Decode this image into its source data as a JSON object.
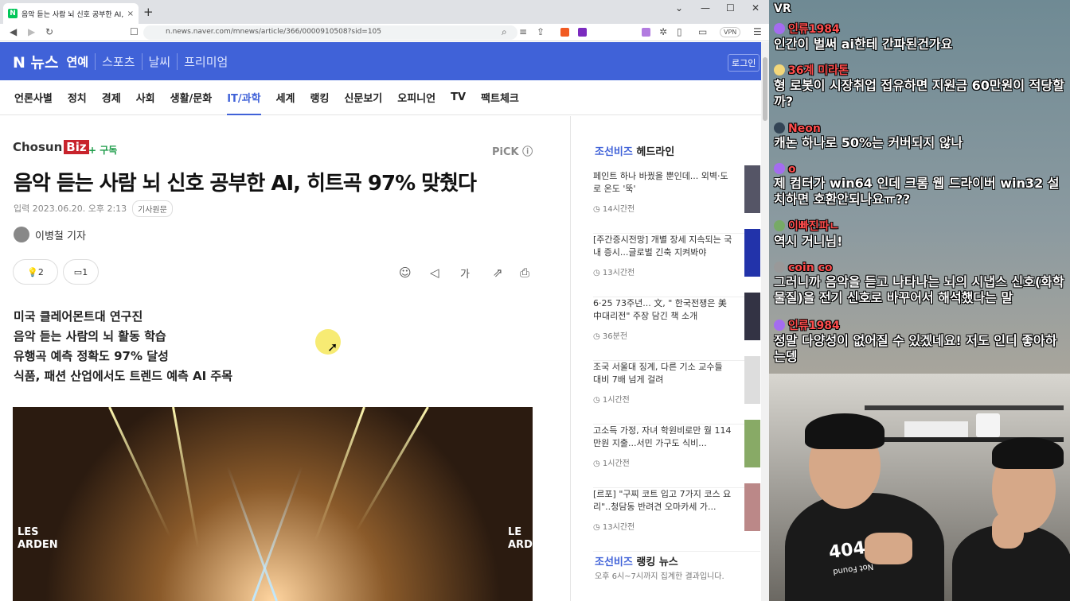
{
  "tab": {
    "title": "음악 듣는 사람 뇌 신호 공부한 AI, 히트곡 97% 맞췄다",
    "favicon": "N",
    "close": "×",
    "newtab": "+"
  },
  "window": {
    "min": "⌄",
    "max": "—",
    "restore": "☐",
    "close": "✕"
  },
  "address": {
    "url": "n.news.naver.com/mnews/article/366/0000910508?sid=105",
    "vpn": "VPN"
  },
  "naver": {
    "logo": "N 뉴스",
    "nav": [
      "연예",
      "스포츠",
      "날씨",
      "프리미엄"
    ],
    "login": "로그인"
  },
  "categories": [
    "언론사별",
    "정치",
    "경제",
    "사회",
    "생활/문화",
    "IT/과학",
    "세계",
    "랭킹",
    "신문보기",
    "오피니언",
    "TV",
    "팩트체크"
  ],
  "article": {
    "press": "Chosun",
    "press_suffix": "Biz",
    "subscribe": "+ 구독",
    "pick": "PiCK ⓘ",
    "headline": "음악 듣는 사람 뇌 신호 공부한 AI, 히트곡 97% 맞췄다",
    "date": "입력 2023.06.20. 오후 2:13",
    "original": "기사원문",
    "reporter": "이병철 기자",
    "reactions": {
      "like_count": "2",
      "comment_count": "1",
      "font_label": "가"
    },
    "summary": [
      "미국 클레어몬트대 연구진",
      "음악 듣는 사람의 뇌 활동 학습",
      "유행곡 예측 정확도 97% 달성",
      "식품, 패션 산업에서도 트렌드 예측 AI 주목"
    ],
    "photo_text_left": "LES ARDEN",
    "photo_text_right": "LE ARD"
  },
  "sidebar": {
    "title_brand": "조선비즈",
    "title": "헤드라인",
    "items": [
      {
        "text": "페인트 하나 바꿨을 뿐인데... 외벽·도로 온도 '뚝'",
        "time": "14시간전"
      },
      {
        "text": "[주간증시전망] 개별 장세 지속되는 국내 증시...글로벌 긴축 지켜봐야",
        "time": "13시간전"
      },
      {
        "text": "6·25 73주년... 文, \" 한국전쟁은 美中대리전\" 주장 담긴 책 소개",
        "time": "36분전"
      },
      {
        "text": "조국 서울대 징계, 다른 기소 교수들 대비 7배 넘게 걸려",
        "time": "1시간전"
      },
      {
        "text": "고소득 가정, 자녀 학원비로만 월 114만원 지출...서민 가구도 식비...",
        "time": "1시간전"
      },
      {
        "text": "[르포] \"구찌 코트 입고 7가지 코스 요리\"..청담동 반려견 오마카세 가...",
        "time": "13시간전"
      }
    ],
    "rank_brand": "조선비즈",
    "rank_title": "랭킹 뉴스",
    "rank_sub": "오후 6시~7시까지 집계한 결과입니다."
  },
  "chat": [
    {
      "user": "VR",
      "text": "",
      "color": "#ffffff"
    },
    {
      "user": "인류1984",
      "text": "인간이 벌써 ai한테 간파된건가요",
      "color": "#ff4d4d"
    },
    {
      "user": "36계 미라톤",
      "text": "형 로봇이 시장취업 접유하면 지원금 60만원이 적당할까?",
      "color": "#ff4d4d"
    },
    {
      "user": "Neon",
      "text": "캐논 하나로 50%는 커버되지 않나",
      "color": "#ff4d4d"
    },
    {
      "user": "o",
      "text": "제 컴터가 win64 인데 크롬 웹 드라이버 win32 설치하면 호환안되나요ㅠ??",
      "color": "#ff4d4d"
    },
    {
      "user": "이빠진파ㄴ",
      "text": "역시 거니님!",
      "color": "#ff4d4d"
    },
    {
      "user": "coin co",
      "text": "그러니까 음악을 듣고 나타나는 뇌의 시냅스 신호(화학물질)을 전기 신호로 바꾸어서 해석했다는 말",
      "color": "#ff4d4d"
    },
    {
      "user": "인류1984",
      "text": "정말 다양성이 없어질 수 있겠네요! 저도 인디 좋아하는뎅",
      "color": "#ff4d4d"
    }
  ],
  "cam": {
    "shirt_text": "404",
    "shirt_sub": "Not Found"
  }
}
